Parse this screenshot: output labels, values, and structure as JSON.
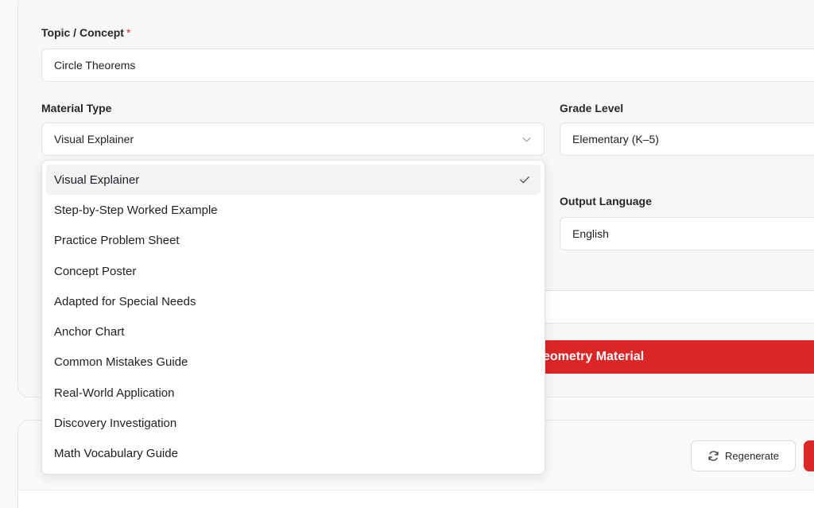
{
  "form": {
    "topic_label": "Topic / Concept",
    "topic_required_mark": "*",
    "topic_value": "Circle Theorems",
    "material_type_label": "Material Type",
    "material_type_value": "Visual Explainer",
    "grade_level_label": "Grade Level",
    "grade_level_value": "Elementary (K–5)",
    "output_language_label": "Output Language",
    "output_language_value": "English",
    "generate_button_label": "Generate Geometry Material",
    "generate_button_visible_text": "eometry Material"
  },
  "dropdown": {
    "selected": "Visual Explainer",
    "options": [
      "Visual Explainer",
      "Step-by-Step Worked Example",
      "Practice Problem Sheet",
      "Concept Poster",
      "Adapted for Special Needs",
      "Anchor Chart",
      "Common Mistakes Guide",
      "Real-World Application",
      "Discovery Investigation",
      "Math Vocabulary Guide"
    ]
  },
  "result": {
    "regenerate_label": "Regenerate"
  },
  "icons": {
    "refresh": "refresh-icon",
    "chevron": "chevron-down-icon",
    "check": "check-icon"
  },
  "colors": {
    "accent": "#dc2626"
  }
}
